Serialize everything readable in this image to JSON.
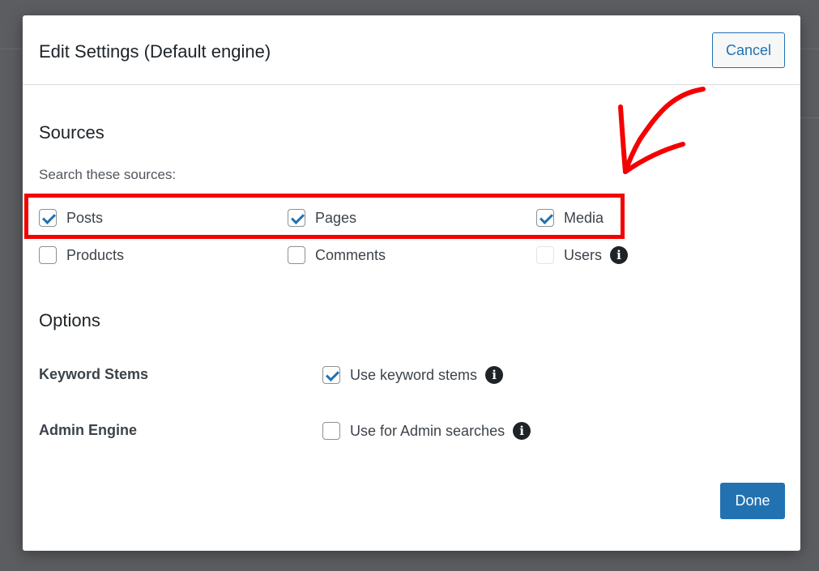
{
  "modal": {
    "title": "Edit Settings (Default engine)",
    "cancel_label": "Cancel",
    "done_label": "Done"
  },
  "sources": {
    "heading": "Sources",
    "prompt": "Search these sources:",
    "items": [
      {
        "label": "Posts",
        "checked": true
      },
      {
        "label": "Pages",
        "checked": true
      },
      {
        "label": "Media",
        "checked": true
      },
      {
        "label": "Products",
        "checked": false
      },
      {
        "label": "Comments",
        "checked": false
      },
      {
        "label": "Users",
        "checked": false,
        "disabled": true,
        "has_info": true
      }
    ]
  },
  "options": {
    "heading": "Options",
    "rows": [
      {
        "label": "Keyword Stems",
        "checkbox_label": "Use keyword stems",
        "checked": true
      },
      {
        "label": "Admin Engine",
        "checkbox_label": "Use for Admin searches",
        "checked": false
      }
    ]
  },
  "annotation": {
    "highlight_color": "#f50000",
    "arrow_color": "#f50000"
  },
  "colors": {
    "accent": "#2271b1",
    "backdrop": "#5c5d60"
  }
}
